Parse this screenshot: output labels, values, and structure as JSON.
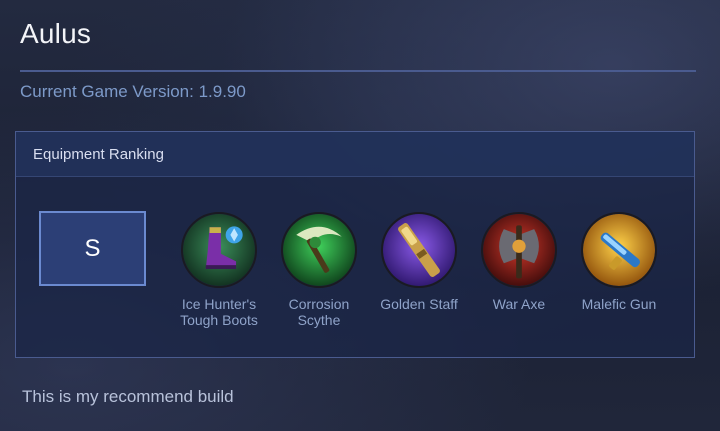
{
  "hero": {
    "name": "Aulus"
  },
  "version": {
    "text": "Current Game Version: 1.9.90"
  },
  "panel": {
    "title": "Equipment Ranking",
    "tier": "S",
    "items": [
      {
        "label_line1": "Ice Hunter's",
        "label_line2": "Tough Boots",
        "icon": "boots-icon",
        "color": "#1f5a3a"
      },
      {
        "label_line1": "Corrosion",
        "label_line2": "Scythe",
        "icon": "scythe-icon",
        "color": "#1d6b2e"
      },
      {
        "label_line1": "Golden Staff",
        "label_line2": "",
        "icon": "staff-icon",
        "color": "#5a2fb0"
      },
      {
        "label_line1": "War Axe",
        "label_line2": "",
        "icon": "axe-icon",
        "color": "#8a1f1f"
      },
      {
        "label_line1": "Malefic Gun",
        "label_line2": "",
        "icon": "gun-icon",
        "color": "#c98a12"
      }
    ]
  },
  "footer": {
    "text": "This is my recommend build"
  }
}
